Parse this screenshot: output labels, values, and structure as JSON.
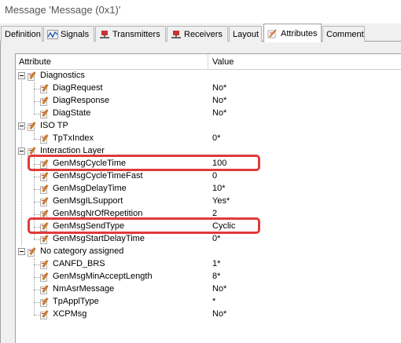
{
  "window": {
    "title": "Message 'Message (0x1)'"
  },
  "tabs": [
    {
      "label": "Definition",
      "icon": "none"
    },
    {
      "label": "Signals",
      "icon": "signals-icon"
    },
    {
      "label": "Transmitters",
      "icon": "transmitter-icon"
    },
    {
      "label": "Receivers",
      "icon": "receiver-icon"
    },
    {
      "label": "Layout",
      "icon": "none"
    },
    {
      "label": "Attributes",
      "icon": "attribute-icon",
      "active": true
    },
    {
      "label": "Comment",
      "icon": "none"
    }
  ],
  "grid": {
    "headers": {
      "attribute": "Attribute",
      "value": "Value"
    },
    "groups": [
      {
        "name": "Diagnostics",
        "items": [
          {
            "name": "DiagRequest",
            "value": "No*"
          },
          {
            "name": "DiagResponse",
            "value": "No*"
          },
          {
            "name": "DiagState",
            "value": "No*"
          }
        ]
      },
      {
        "name": "ISO TP",
        "items": [
          {
            "name": "TpTxIndex",
            "value": "0*"
          }
        ]
      },
      {
        "name": "Interaction Layer",
        "items": [
          {
            "name": "GenMsgCycleTime",
            "value": "100",
            "highlighted": true
          },
          {
            "name": "GenMsgCycleTimeFast",
            "value": "0"
          },
          {
            "name": "GenMsgDelayTime",
            "value": "10*"
          },
          {
            "name": "GenMsgILSupport",
            "value": "Yes*"
          },
          {
            "name": "GenMsgNrOfRepetition",
            "value": "2"
          },
          {
            "name": "GenMsgSendType",
            "value": "Cyclic",
            "highlighted": true
          },
          {
            "name": "GenMsgStartDelayTime",
            "value": "0*"
          }
        ]
      },
      {
        "name": "No category assigned",
        "items": [
          {
            "name": "CANFD_BRS",
            "value": "1*"
          },
          {
            "name": "GenMsgMinAcceptLength",
            "value": "8*"
          },
          {
            "name": "NmAsrMessage",
            "value": "No*"
          },
          {
            "name": "TpApplType",
            "value": "*"
          },
          {
            "name": "XCPMsg",
            "value": "No*"
          }
        ]
      }
    ]
  },
  "colors": {
    "highlight": "#e03a3a",
    "pen": "#c97b2a"
  }
}
